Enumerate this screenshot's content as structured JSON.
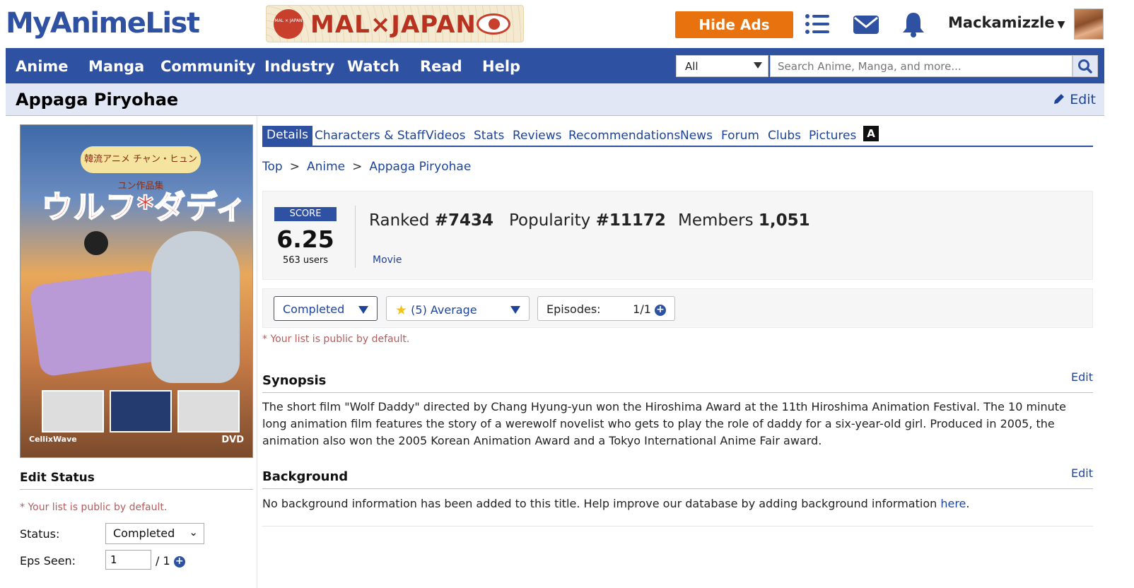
{
  "header": {
    "logo": "MyAnimeList",
    "banner": {
      "circle_text": "MAL × JAPAN",
      "title": "MAL×JAPAN"
    },
    "hide_ads": "Hide Ads",
    "username": "Mackamizzle",
    "icons": [
      "list-icon",
      "envelope-icon",
      "bell-icon",
      "avatar"
    ]
  },
  "nav": {
    "items": [
      "Anime",
      "Manga",
      "Community",
      "Industry",
      "Watch",
      "Read",
      "Help"
    ],
    "search_category": "All",
    "search_placeholder": "Search Anime, Manga, and more..."
  },
  "title_bar": {
    "title": "Appaga Piryohae",
    "edit": "Edit"
  },
  "poster": {
    "jp_top": "韓流アニメ チャン・ヒュンユン作品集",
    "jp_title": "ウルフ*ダディ",
    "logo_left": "CellixWave",
    "logo_right": "DVD"
  },
  "left": {
    "heading": "Edit Status",
    "note": "* Your list is public by default.",
    "status_label": "Status:",
    "status_value": "Completed",
    "eps_label": "Eps Seen:",
    "eps_value": "1",
    "eps_total": "/ 1"
  },
  "tabs": [
    "Details",
    "Characters & Staff",
    "Videos",
    "Stats",
    "Reviews",
    "Recommendations",
    "News",
    "Forum",
    "Clubs",
    "Pictures"
  ],
  "tab_icon": "A",
  "breadcrumb": [
    "Top",
    "Anime",
    "Appaga Piryohae"
  ],
  "stats": {
    "score_label": "SCORE",
    "score": "6.25",
    "users": "563 users",
    "ranked_label": "Ranked",
    "ranked": "#7434",
    "popularity_label": "Popularity",
    "popularity": "#11172",
    "members_label": "Members",
    "members": "1,051",
    "type": "Movie"
  },
  "list_controls": {
    "status": "Completed",
    "score": "(5) Average",
    "episodes_label": "Episodes:",
    "episodes": "1/1"
  },
  "public_note": "* Your list is public by default.",
  "synopsis": {
    "heading": "Synopsis",
    "edit": "Edit",
    "text": "The short film \"Wolf Daddy\" directed by Chang Hyung-yun won the Hiroshima Award at the 11th Hiroshima Animation Festival. The 10 minute long animation film features the story of a werewolf novelist who gets to play the role of daddy for a six-year-old girl. Produced in 2005, the animation also won the 2005 Korean Animation Award and a Tokyo International Anime Fair award."
  },
  "background": {
    "heading": "Background",
    "edit": "Edit",
    "text": "No background information has been added to this title. Help improve our database by adding background information ",
    "link": "here",
    "end": "."
  },
  "colors": {
    "brand": "#2e51a2",
    "ads": "#e8720d",
    "title_bg": "#e1e7f5",
    "note": "#b25c5c"
  }
}
